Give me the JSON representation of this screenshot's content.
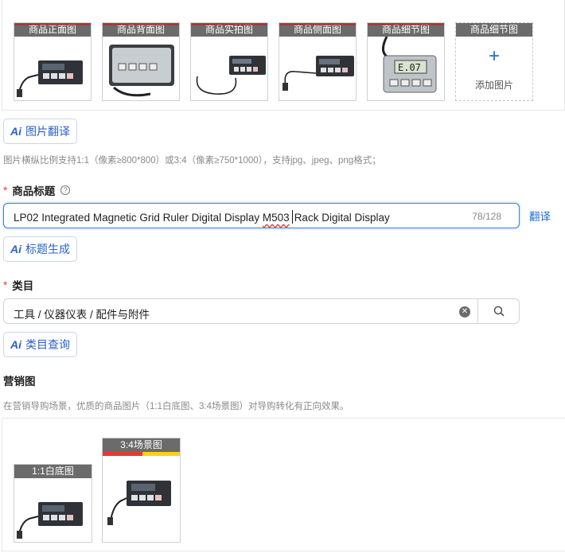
{
  "images": {
    "tiles": [
      {
        "label": "商品正面图"
      },
      {
        "label": "商品背面图"
      },
      {
        "label": "商品实拍图"
      },
      {
        "label": "商品侧面图"
      },
      {
        "label": "商品细节图"
      }
    ],
    "add_tile": {
      "label": "商品细节图",
      "action": "添加图片"
    }
  },
  "image_translate_button": "图片翻译",
  "image_hint": "图片横纵比例支持1:1（像素≥800*800）或3:4（像素≥750*1000），支持jpg、jpeg、png格式；",
  "title_field": {
    "label": "商品标题",
    "value_start": "LP02 Integrated Magnetic Grid Ruler Digital Display ",
    "value_squiggle": "M503",
    "value_end": "Rack Digital Display",
    "count": "78/128",
    "translate_link": "翻译",
    "generate_button": "标题生成"
  },
  "category_field": {
    "label": "类目",
    "value": "工具 / 仪器仪表 / 配件与附件",
    "query_button": "类目查询"
  },
  "marketing": {
    "label": "营销图",
    "hint": "在营销导购场景，优质的商品图片（1:1白底图、3:4场景图）对导购转化有正向效果。",
    "tiles": [
      {
        "label": "1:1白底图"
      },
      {
        "label": "3:4场景图"
      }
    ]
  },
  "colors": {
    "accent": "#1a6dd6",
    "required": "#e23b3b"
  },
  "icons": {
    "ai": "ai-badge",
    "clear": "clear-circle-icon",
    "search": "search-icon",
    "help": "question-circle-icon"
  }
}
